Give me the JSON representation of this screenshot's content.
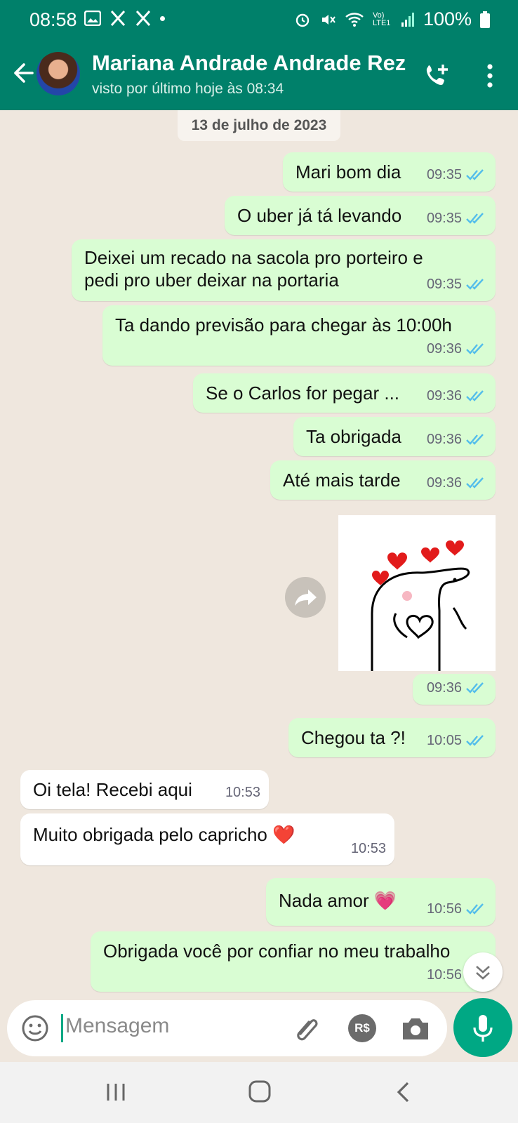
{
  "status_bar": {
    "time": "08:58",
    "battery": "100%",
    "network": "Vo) LTE1"
  },
  "header": {
    "contact_name": "Mariana Andrade Andrade Rez",
    "last_seen": "visto por último hoje às 08:34",
    "accent": "#00806a"
  },
  "chat": {
    "date_chip": "13 de julho de 2023",
    "messages": [
      {
        "dir": "out",
        "text": "Mari bom dia",
        "time": "09:35"
      },
      {
        "dir": "out",
        "text": "O uber já tá levando",
        "time": "09:35"
      },
      {
        "dir": "out",
        "text_lines": [
          "Deixei um recado na sacola pro porteiro e",
          "pedi pro uber deixar na portaria"
        ],
        "time": "09:35"
      },
      {
        "dir": "out",
        "text": "Ta dando previsão para chegar às 10:00h",
        "time": "09:36"
      },
      {
        "dir": "out",
        "text": "Se o Carlos for pegar ...",
        "time": "09:36"
      },
      {
        "dir": "out",
        "text": "Ta obrigada",
        "time": "09:36"
      },
      {
        "dir": "out",
        "text": "Até mais tarde",
        "time": "09:36"
      },
      {
        "dir": "out",
        "type": "sticker",
        "time": "09:36"
      },
      {
        "dir": "out",
        "text": "Chegou ta ?!",
        "time": "10:05"
      },
      {
        "dir": "in",
        "text": "Oi tela! Recebi aqui",
        "time": "10:53"
      },
      {
        "dir": "in",
        "text": "Muito obrigada pelo capricho ❤️",
        "time": "10:53"
      },
      {
        "dir": "out",
        "text": "Nada amor 💗",
        "time": "10:56"
      },
      {
        "dir": "out",
        "text": "Obrigada você por confiar no meu trabalho",
        "time": "10:56"
      }
    ]
  },
  "composer": {
    "placeholder": "Mensagem",
    "currency_badge": "R$"
  },
  "colors": {
    "outgoing_bubble": "#d9fdd3",
    "incoming_bubble": "#ffffff",
    "read_ticks": "#53bdeb",
    "mic_button": "#00a884"
  }
}
